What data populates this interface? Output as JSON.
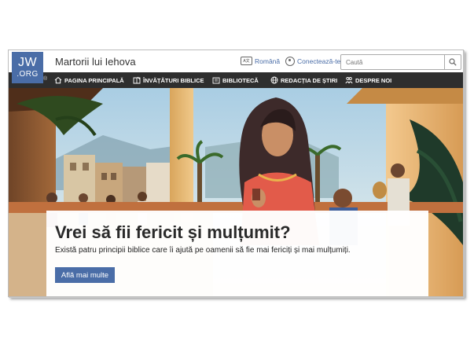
{
  "brand": {
    "logo_line1": "JW",
    "logo_line2": ".ORG",
    "registered": "®",
    "site_title": "Martorii lui Iehova",
    "accent": "#4a6da7",
    "nav_bg": "#2e2e2e"
  },
  "header": {
    "language_label": "Română",
    "language_icon_text": "A文",
    "login_label": "Conectează-te"
  },
  "search": {
    "placeholder": "Caută",
    "value": ""
  },
  "nav": {
    "items": [
      {
        "label": "PAGINA PRINCIPALĂ",
        "icon": "home-icon"
      },
      {
        "label": "ÎNVĂȚĂTURI BIBLICE",
        "icon": "bible-teachings-icon"
      },
      {
        "label": "BIBLIOTECĂ",
        "icon": "library-icon"
      },
      {
        "label": "REDACȚIA DE ȘTIRI",
        "icon": "globe-icon"
      },
      {
        "label": "DESPRE NOI",
        "icon": "people-icon"
      }
    ]
  },
  "hero": {
    "headline": "Vrei să fii fericit și mulțumit?",
    "subtext": "Există patru principii biblice care îi ajută pe oamenii să fie mai fericiți și mai mulțumiți.",
    "cta_label": "Află mai multe"
  }
}
